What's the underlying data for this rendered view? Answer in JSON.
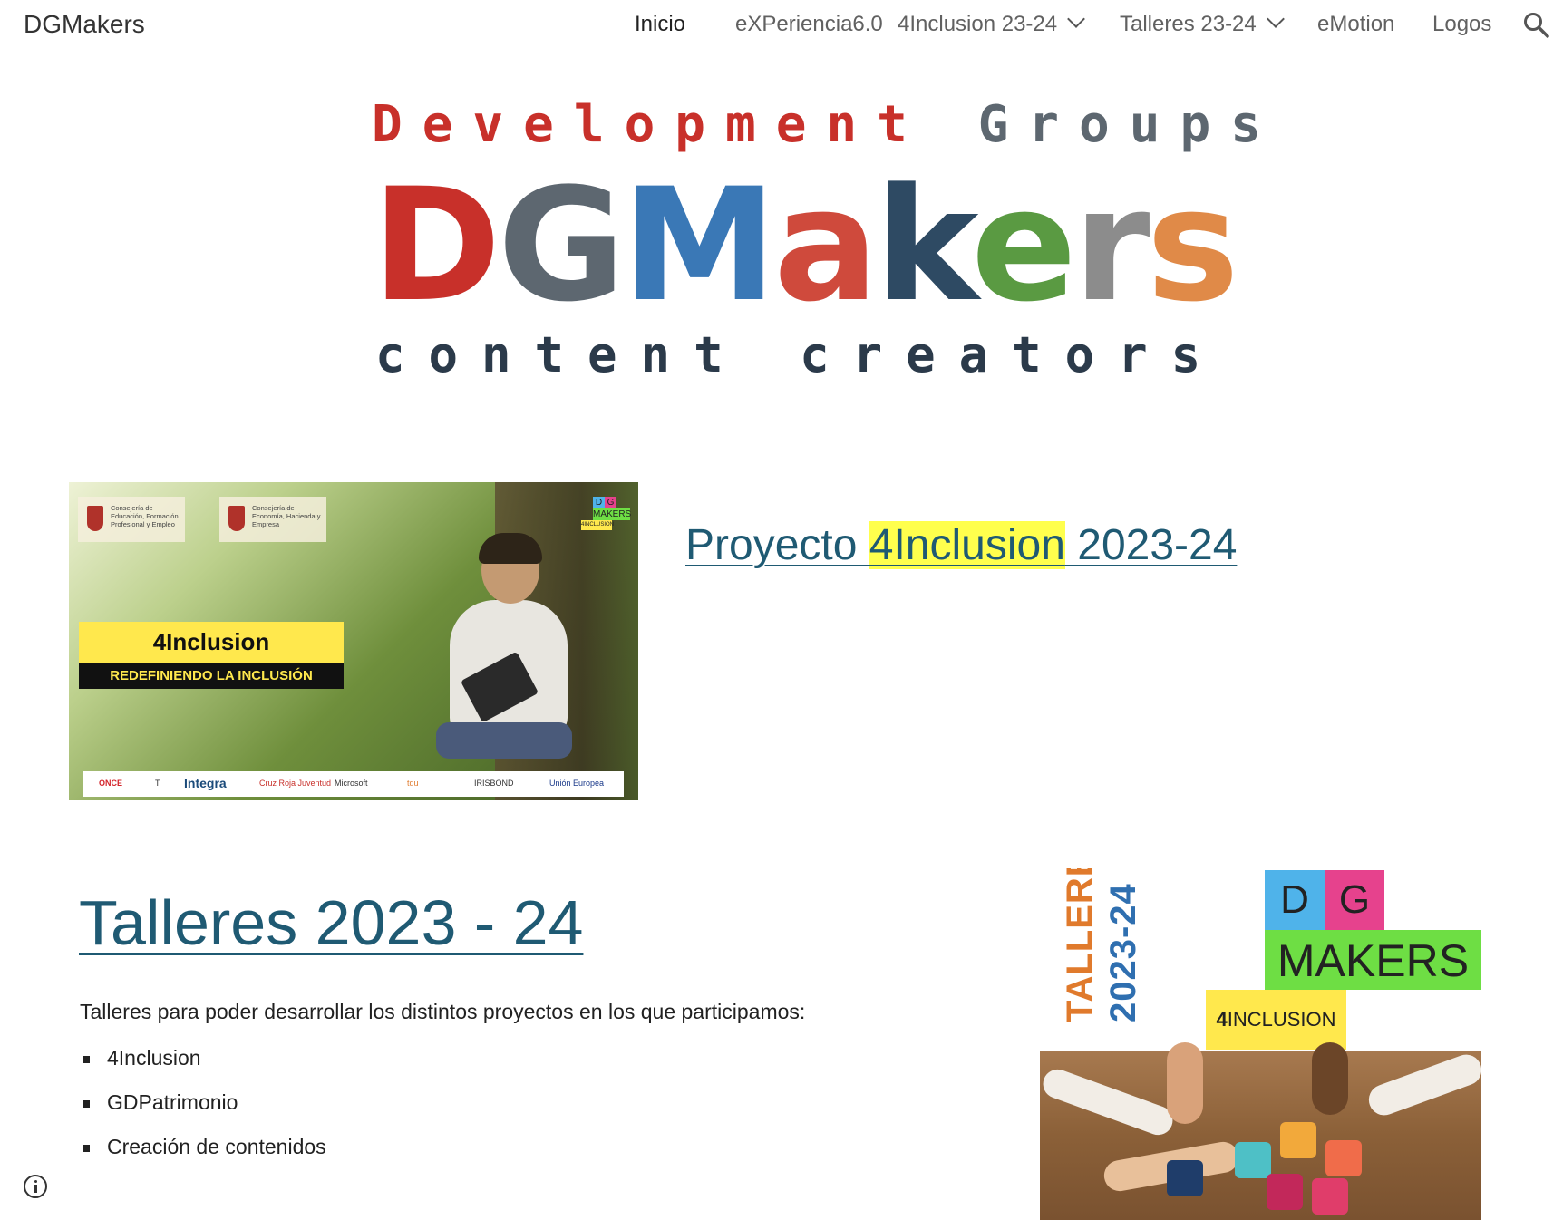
{
  "site": {
    "title": "DGMakers"
  },
  "nav": {
    "items": [
      {
        "label": "Inicio",
        "active": true
      },
      {
        "label": "eXPeriencia6.0"
      },
      {
        "label": "4Inclusion 23-24",
        "has_dropdown": true
      },
      {
        "label": "Talleres 23-24",
        "has_dropdown": true
      },
      {
        "label": "eMotion"
      },
      {
        "label": "Logos"
      }
    ],
    "search_icon": "search-icon"
  },
  "logo": {
    "line1_a": "Development",
    "line1_b": "Groups",
    "line2": [
      "D",
      "G",
      "M",
      "a",
      "k",
      "e",
      "r",
      "s"
    ],
    "line2_colors": [
      "#c8302a",
      "#5d6770",
      "#3a78b6",
      "#cf4a3c",
      "#2e4a63",
      "#5a9a42",
      "#8c8c8c",
      "#e08a48"
    ],
    "line3": "content creators",
    "colors": {
      "line1_a": "#c8302a",
      "line1_b": "#5d6770",
      "line3": "#2b3a4a"
    }
  },
  "hero": {
    "badge1": "Consejería de Educación, Formación Profesional y Empleo",
    "badge2": "Consejería de Economía, Hacienda y Empresa",
    "dg_logo": {
      "d": "D",
      "g": "G",
      "makers": "MAKERS",
      "tag": "4INCLUSION"
    },
    "banner": "4Inclusion",
    "subtitle": "REDEFINIENDO LA INCLUSIÓN",
    "sponsors": [
      "ONCE",
      "T",
      "Integra",
      "Cruz Roja Juventud",
      "Microsoft",
      "tdu",
      "IRISBOND",
      "Unión Europea"
    ]
  },
  "project": {
    "link_prefix": "Proyecto ",
    "link_highlight": "4Inclusion",
    "link_suffix": " 2023-24",
    "highlight_color": "#ffff4d"
  },
  "talleres": {
    "heading": "Talleres 2023 - 24",
    "description": "Talleres para poder desarrollar los distintos proyectos en los que participamos:",
    "items": [
      "4Inclusion",
      "GDPatrimonio",
      "Creación de contenidos"
    ],
    "image": {
      "vertical_1": "TALLERES",
      "vertical_2": "2023-24",
      "d": "D",
      "g": "G",
      "makers": "MAKERS",
      "tag_bold": "4",
      "tag_rest": "INCLUSION"
    }
  },
  "info_icon": "info-icon"
}
